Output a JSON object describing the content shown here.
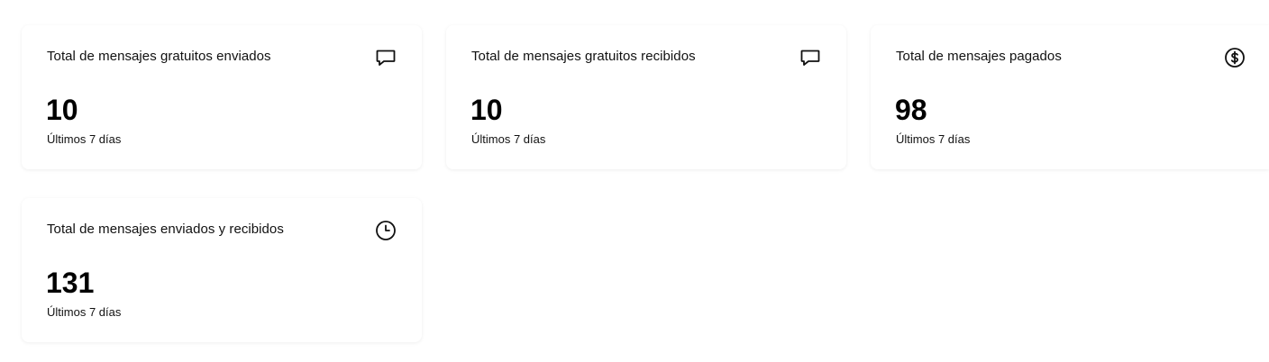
{
  "cards": [
    {
      "title": "Total de mensajes gratuitos enviados",
      "value": "10",
      "period": "Últimos 7 días",
      "icon": "message-icon"
    },
    {
      "title": "Total de mensajes gratuitos recibidos",
      "value": "10",
      "period": "Últimos 7 días",
      "icon": "message-icon"
    },
    {
      "title": "Total de mensajes pagados",
      "value": "98",
      "period": "Últimos 7 días",
      "icon": "dollar-circle-icon"
    },
    {
      "title": "Total de mensajes enviados y recibidos",
      "value": "131",
      "period": "Últimos 7 días",
      "icon": "clock-icon"
    }
  ]
}
